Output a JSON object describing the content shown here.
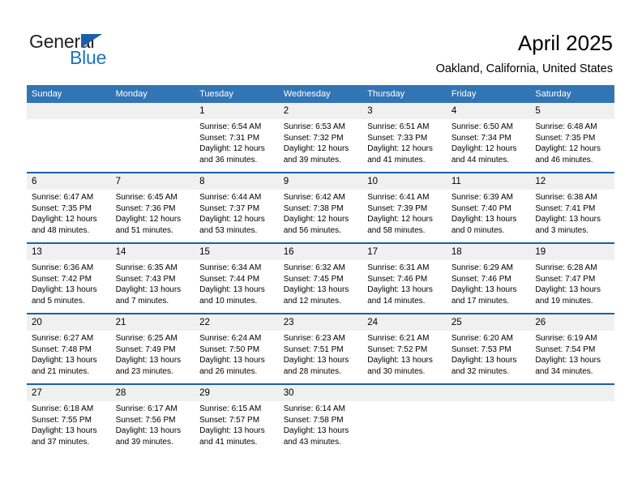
{
  "brand": {
    "word1": "General",
    "word2": "Blue",
    "triangle_color": "#1b5fa8",
    "blue_color": "#1b75bb"
  },
  "header": {
    "title": "April 2025",
    "subtitle": "Oakland, California, United States"
  },
  "theme": {
    "header_bg": "#3275b5",
    "row_divider": "#1b5fa8",
    "daynum_bg": "#f0f0f0"
  },
  "calendar": {
    "weekday_headers": [
      "Sunday",
      "Monday",
      "Tuesday",
      "Wednesday",
      "Thursday",
      "Friday",
      "Saturday"
    ],
    "weeks": [
      [
        {
          "day": "",
          "sunrise": "",
          "sunset": "",
          "daylight1": "",
          "daylight2": ""
        },
        {
          "day": "",
          "sunrise": "",
          "sunset": "",
          "daylight1": "",
          "daylight2": ""
        },
        {
          "day": "1",
          "sunrise": "Sunrise: 6:54 AM",
          "sunset": "Sunset: 7:31 PM",
          "daylight1": "Daylight: 12 hours",
          "daylight2": "and 36 minutes."
        },
        {
          "day": "2",
          "sunrise": "Sunrise: 6:53 AM",
          "sunset": "Sunset: 7:32 PM",
          "daylight1": "Daylight: 12 hours",
          "daylight2": "and 39 minutes."
        },
        {
          "day": "3",
          "sunrise": "Sunrise: 6:51 AM",
          "sunset": "Sunset: 7:33 PM",
          "daylight1": "Daylight: 12 hours",
          "daylight2": "and 41 minutes."
        },
        {
          "day": "4",
          "sunrise": "Sunrise: 6:50 AM",
          "sunset": "Sunset: 7:34 PM",
          "daylight1": "Daylight: 12 hours",
          "daylight2": "and 44 minutes."
        },
        {
          "day": "5",
          "sunrise": "Sunrise: 6:48 AM",
          "sunset": "Sunset: 7:35 PM",
          "daylight1": "Daylight: 12 hours",
          "daylight2": "and 46 minutes."
        }
      ],
      [
        {
          "day": "6",
          "sunrise": "Sunrise: 6:47 AM",
          "sunset": "Sunset: 7:35 PM",
          "daylight1": "Daylight: 12 hours",
          "daylight2": "and 48 minutes."
        },
        {
          "day": "7",
          "sunrise": "Sunrise: 6:45 AM",
          "sunset": "Sunset: 7:36 PM",
          "daylight1": "Daylight: 12 hours",
          "daylight2": "and 51 minutes."
        },
        {
          "day": "8",
          "sunrise": "Sunrise: 6:44 AM",
          "sunset": "Sunset: 7:37 PM",
          "daylight1": "Daylight: 12 hours",
          "daylight2": "and 53 minutes."
        },
        {
          "day": "9",
          "sunrise": "Sunrise: 6:42 AM",
          "sunset": "Sunset: 7:38 PM",
          "daylight1": "Daylight: 12 hours",
          "daylight2": "and 56 minutes."
        },
        {
          "day": "10",
          "sunrise": "Sunrise: 6:41 AM",
          "sunset": "Sunset: 7:39 PM",
          "daylight1": "Daylight: 12 hours",
          "daylight2": "and 58 minutes."
        },
        {
          "day": "11",
          "sunrise": "Sunrise: 6:39 AM",
          "sunset": "Sunset: 7:40 PM",
          "daylight1": "Daylight: 13 hours",
          "daylight2": "and 0 minutes."
        },
        {
          "day": "12",
          "sunrise": "Sunrise: 6:38 AM",
          "sunset": "Sunset: 7:41 PM",
          "daylight1": "Daylight: 13 hours",
          "daylight2": "and 3 minutes."
        }
      ],
      [
        {
          "day": "13",
          "sunrise": "Sunrise: 6:36 AM",
          "sunset": "Sunset: 7:42 PM",
          "daylight1": "Daylight: 13 hours",
          "daylight2": "and 5 minutes."
        },
        {
          "day": "14",
          "sunrise": "Sunrise: 6:35 AM",
          "sunset": "Sunset: 7:43 PM",
          "daylight1": "Daylight: 13 hours",
          "daylight2": "and 7 minutes."
        },
        {
          "day": "15",
          "sunrise": "Sunrise: 6:34 AM",
          "sunset": "Sunset: 7:44 PM",
          "daylight1": "Daylight: 13 hours",
          "daylight2": "and 10 minutes."
        },
        {
          "day": "16",
          "sunrise": "Sunrise: 6:32 AM",
          "sunset": "Sunset: 7:45 PM",
          "daylight1": "Daylight: 13 hours",
          "daylight2": "and 12 minutes."
        },
        {
          "day": "17",
          "sunrise": "Sunrise: 6:31 AM",
          "sunset": "Sunset: 7:46 PM",
          "daylight1": "Daylight: 13 hours",
          "daylight2": "and 14 minutes."
        },
        {
          "day": "18",
          "sunrise": "Sunrise: 6:29 AM",
          "sunset": "Sunset: 7:46 PM",
          "daylight1": "Daylight: 13 hours",
          "daylight2": "and 17 minutes."
        },
        {
          "day": "19",
          "sunrise": "Sunrise: 6:28 AM",
          "sunset": "Sunset: 7:47 PM",
          "daylight1": "Daylight: 13 hours",
          "daylight2": "and 19 minutes."
        }
      ],
      [
        {
          "day": "20",
          "sunrise": "Sunrise: 6:27 AM",
          "sunset": "Sunset: 7:48 PM",
          "daylight1": "Daylight: 13 hours",
          "daylight2": "and 21 minutes."
        },
        {
          "day": "21",
          "sunrise": "Sunrise: 6:25 AM",
          "sunset": "Sunset: 7:49 PM",
          "daylight1": "Daylight: 13 hours",
          "daylight2": "and 23 minutes."
        },
        {
          "day": "22",
          "sunrise": "Sunrise: 6:24 AM",
          "sunset": "Sunset: 7:50 PM",
          "daylight1": "Daylight: 13 hours",
          "daylight2": "and 26 minutes."
        },
        {
          "day": "23",
          "sunrise": "Sunrise: 6:23 AM",
          "sunset": "Sunset: 7:51 PM",
          "daylight1": "Daylight: 13 hours",
          "daylight2": "and 28 minutes."
        },
        {
          "day": "24",
          "sunrise": "Sunrise: 6:21 AM",
          "sunset": "Sunset: 7:52 PM",
          "daylight1": "Daylight: 13 hours",
          "daylight2": "and 30 minutes."
        },
        {
          "day": "25",
          "sunrise": "Sunrise: 6:20 AM",
          "sunset": "Sunset: 7:53 PM",
          "daylight1": "Daylight: 13 hours",
          "daylight2": "and 32 minutes."
        },
        {
          "day": "26",
          "sunrise": "Sunrise: 6:19 AM",
          "sunset": "Sunset: 7:54 PM",
          "daylight1": "Daylight: 13 hours",
          "daylight2": "and 34 minutes."
        }
      ],
      [
        {
          "day": "27",
          "sunrise": "Sunrise: 6:18 AM",
          "sunset": "Sunset: 7:55 PM",
          "daylight1": "Daylight: 13 hours",
          "daylight2": "and 37 minutes."
        },
        {
          "day": "28",
          "sunrise": "Sunrise: 6:17 AM",
          "sunset": "Sunset: 7:56 PM",
          "daylight1": "Daylight: 13 hours",
          "daylight2": "and 39 minutes."
        },
        {
          "day": "29",
          "sunrise": "Sunrise: 6:15 AM",
          "sunset": "Sunset: 7:57 PM",
          "daylight1": "Daylight: 13 hours",
          "daylight2": "and 41 minutes."
        },
        {
          "day": "30",
          "sunrise": "Sunrise: 6:14 AM",
          "sunset": "Sunset: 7:58 PM",
          "daylight1": "Daylight: 13 hours",
          "daylight2": "and 43 minutes."
        },
        {
          "day": "",
          "sunrise": "",
          "sunset": "",
          "daylight1": "",
          "daylight2": ""
        },
        {
          "day": "",
          "sunrise": "",
          "sunset": "",
          "daylight1": "",
          "daylight2": ""
        },
        {
          "day": "",
          "sunrise": "",
          "sunset": "",
          "daylight1": "",
          "daylight2": ""
        }
      ]
    ]
  }
}
